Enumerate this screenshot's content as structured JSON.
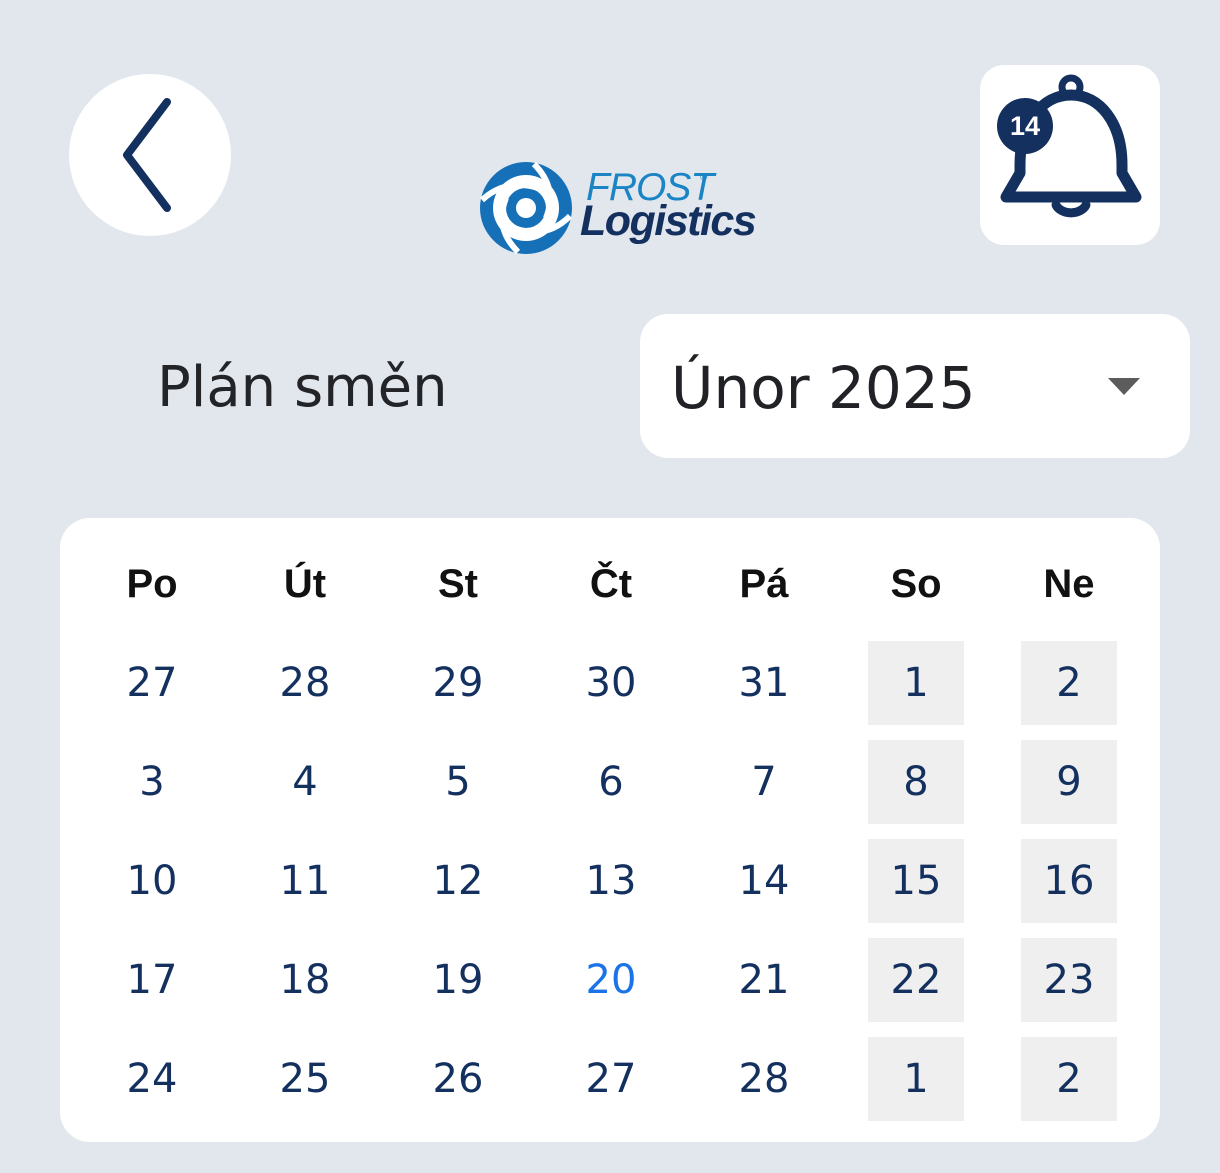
{
  "header": {
    "back_icon": "chevron-left-icon",
    "logo": {
      "line1": "FROST",
      "registered": "®",
      "line2": "Logistics"
    },
    "notifications": {
      "icon": "bell-icon",
      "count": "14"
    }
  },
  "page": {
    "title": "Plán směn"
  },
  "month_selector": {
    "value": "Únor 2025",
    "icon": "caret-down-icon"
  },
  "calendar": {
    "weekdays": [
      "Po",
      "Út",
      "St",
      "Čt",
      "Pá",
      "So",
      "Ne"
    ],
    "today": "20",
    "weeks": [
      [
        "27",
        "28",
        "29",
        "30",
        "31",
        "1",
        "2"
      ],
      [
        "3",
        "4",
        "5",
        "6",
        "7",
        "8",
        "9"
      ],
      [
        "10",
        "11",
        "12",
        "13",
        "14",
        "15",
        "16"
      ],
      [
        "17",
        "18",
        "19",
        "20",
        "21",
        "22",
        "23"
      ],
      [
        "24",
        "25",
        "26",
        "27",
        "28",
        "1",
        "2"
      ]
    ]
  },
  "colors": {
    "background": "#e2e7ee",
    "primary_navy": "#13305f",
    "today_blue": "#1a73e8",
    "weekend_cell": "#efefef"
  }
}
